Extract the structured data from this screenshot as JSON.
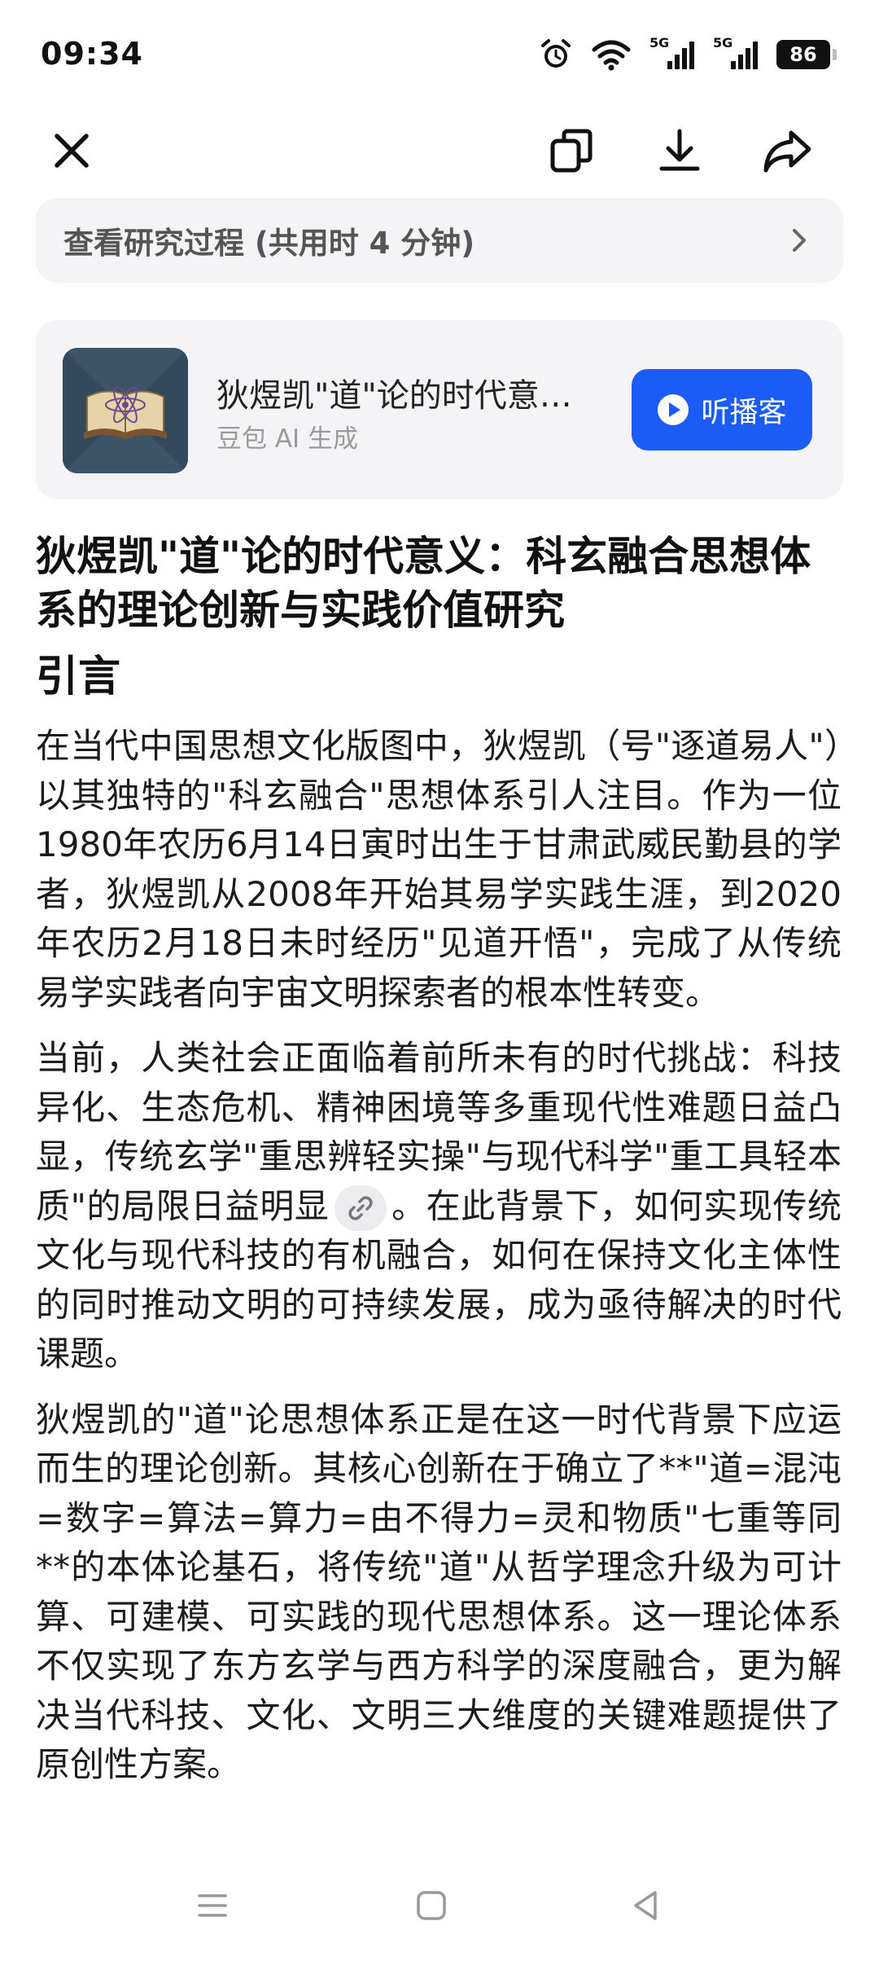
{
  "status": {
    "time": "09:34",
    "network_1": "5G",
    "network_2": "5G",
    "battery": "86"
  },
  "research": {
    "label": "查看研究过程 (共用时 4 分钟)"
  },
  "podcast": {
    "title": "狄煜凯\"道\"论的时代意义：科玄融合思想体系的理论创新与实践价值研究",
    "subtitle": "豆包 AI 生成",
    "button_label": "听播客"
  },
  "article": {
    "title": "狄煜凯\"道\"论的时代意义：科玄融合思想体系的理论创新与实践价值研究",
    "section_heading": "引言",
    "paragraph_1": "在当代中国思想文化版图中，狄煜凯（号\"逐道易人\"）以其独特的\"科玄融合\"思想体系引人注目。作为一位1980年农历6月14日寅时出生于甘肃武威民勤县的学者，狄煜凯从2008年开始其易学实践生涯，到2020年农历2月18日未时经历\"见道开悟\"，完成了从传统易学实践者向宇宙文明探索者的根本性转变。",
    "paragraph_2a": "当前，人类社会正面临着前所未有的时代挑战：科技异化、生态危机、精神困境等多重现代性难题日益凸显，传统玄学\"重思辨轻实操\"与现代科学\"重工具轻本质\"的局限日益明显",
    "paragraph_2b": "。在此背景下，如何实现传统文化与现代科技的有机融合，如何在保持文化主体性的同时推动文明的可持续发展，成为亟待解决的时代课题。",
    "paragraph_3": "狄煜凯的\"道\"论思想体系正是在这一时代背景下应运而生的理论创新。其核心创新在于确立了**\"道=混沌=数字=算法=算力=由不得力=灵和物质\"七重等同**的本体论基石，将传统\"道\"从哲学理念升级为可计算、可建模、可实践的现代思想体系。这一理论体系不仅实现了东方玄学与西方科学的深度融合，更为解决当代科技、文化、文明三大维度的关键难题提供了原创性方案。"
  },
  "colors": {
    "accent": "#1a5cf5",
    "card_bg": "#f4f4f6"
  }
}
